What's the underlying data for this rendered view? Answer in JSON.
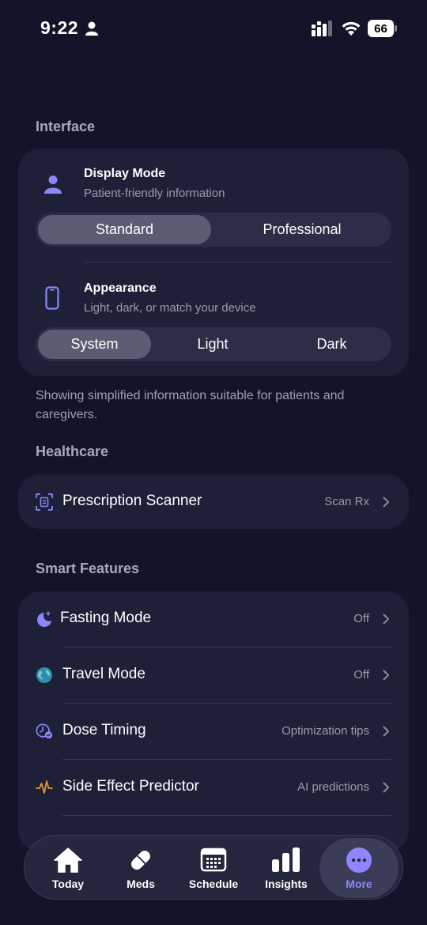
{
  "status_bar": {
    "time": "9:22",
    "battery": "66"
  },
  "interface": {
    "header": "Interface",
    "display_mode": {
      "title": "Display Mode",
      "subtitle": "Patient-friendly information",
      "options": [
        "Standard",
        "Professional"
      ],
      "selected": "Standard"
    },
    "appearance": {
      "title": "Appearance",
      "subtitle": "Light, dark, or match your device",
      "options": [
        "System",
        "Light",
        "Dark"
      ],
      "selected": "System"
    },
    "footnote": "Showing simplified information suitable for patients and caregivers."
  },
  "healthcare": {
    "header": "Healthcare",
    "items": [
      {
        "label": "Prescription Scanner",
        "value": "Scan Rx",
        "icon": "document-scan-icon"
      }
    ]
  },
  "smart_features": {
    "header": "Smart Features",
    "items": [
      {
        "label": "Fasting Mode",
        "value": "Off",
        "icon": "moon-stars-icon"
      },
      {
        "label": "Travel Mode",
        "value": "Off",
        "icon": "globe-icon"
      },
      {
        "label": "Dose Timing",
        "value": "Optimization tips",
        "icon": "clock-check-icon"
      },
      {
        "label": "Side Effect Predictor",
        "value": "AI predictions",
        "icon": "waveform-icon"
      }
    ]
  },
  "tab_bar": {
    "tabs": [
      {
        "label": "Today",
        "icon": "house-icon"
      },
      {
        "label": "Meds",
        "icon": "pill-icon"
      },
      {
        "label": "Schedule",
        "icon": "calendar-icon"
      },
      {
        "label": "Insights",
        "icon": "bar-chart-icon"
      },
      {
        "label": "More",
        "icon": "ellipsis-icon"
      }
    ],
    "active": "More"
  },
  "colors": {
    "background": "#13132a",
    "card": "#1e2038",
    "accent": "#8f86ff",
    "orange_icon": "#e8953a",
    "teal_icon": "#3fb6c9"
  }
}
